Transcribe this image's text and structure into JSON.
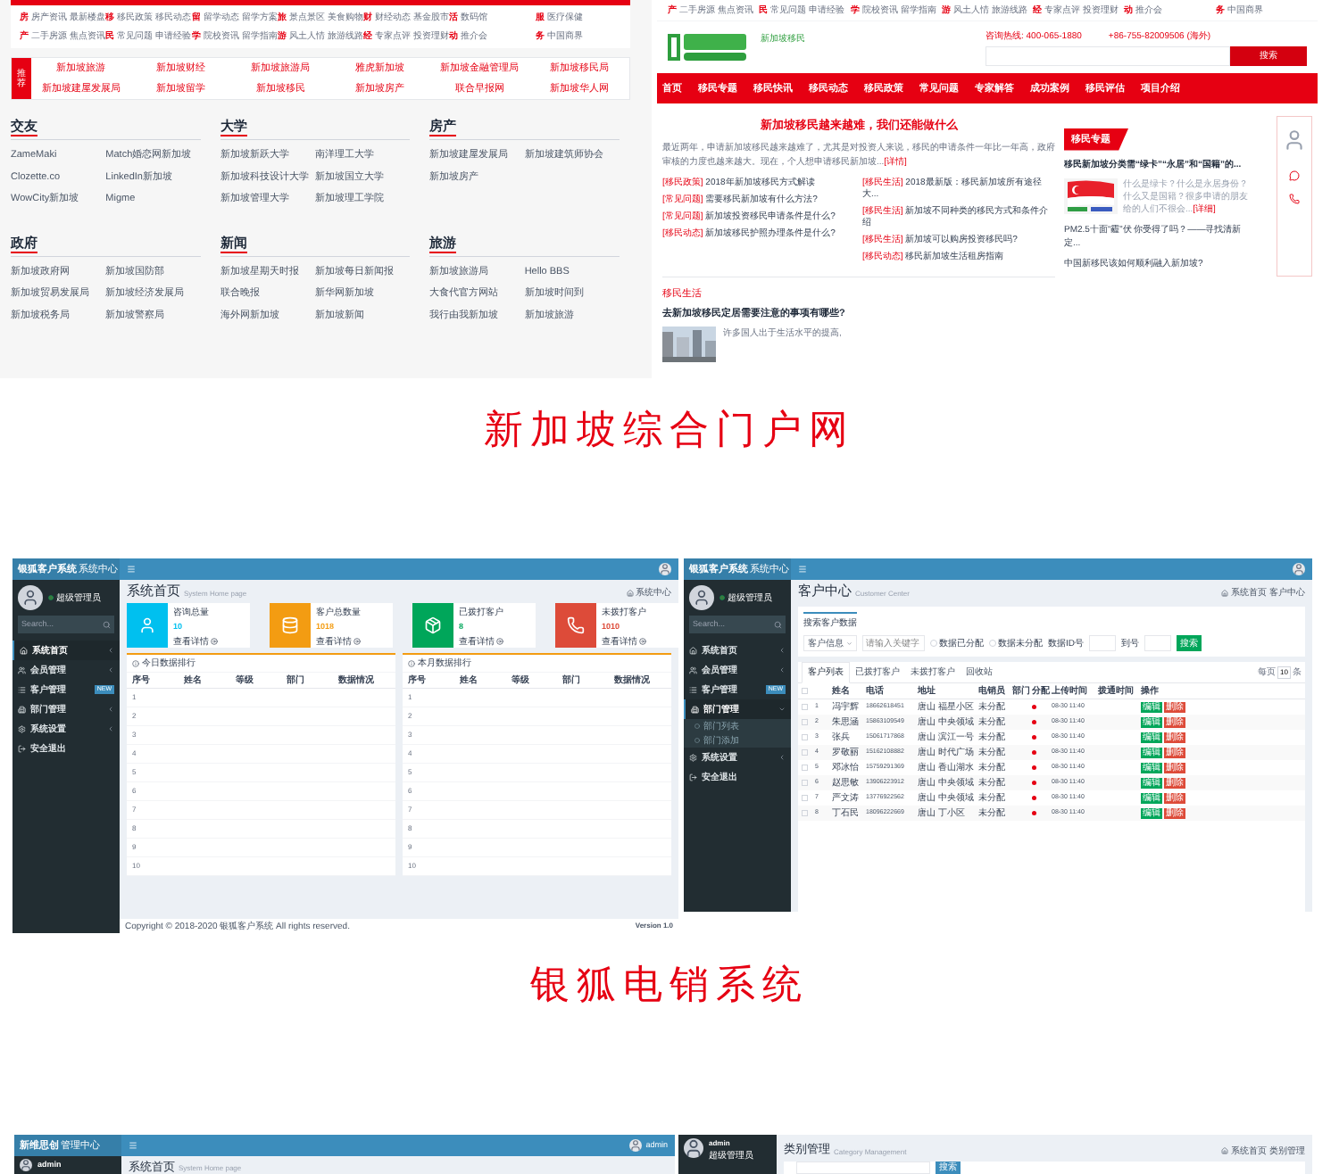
{
  "portal_site": {
    "top_nav": [
      [
        {
          "icon": "房",
          "items": [
            "房产资讯",
            "最新楼盘"
          ]
        },
        {
          "icon": "移",
          "items": [
            "移民政策",
            "移民动态"
          ]
        },
        {
          "icon": "留",
          "items": [
            "留学动态",
            "留学方案"
          ]
        },
        {
          "icon": "旅",
          "items": [
            "景点景区",
            "美食购物"
          ]
        },
        {
          "icon": "财",
          "items": [
            "财经动态",
            "基金股市"
          ]
        },
        {
          "icon": "活",
          "items": [
            "数码馆"
          ]
        },
        {
          "icon": "服",
          "items": [
            "医疗保健"
          ]
        }
      ],
      [
        {
          "icon": "产",
          "items": [
            "二手房源",
            "焦点资讯"
          ]
        },
        {
          "icon": "民",
          "items": [
            "常见问题",
            "申请经验"
          ]
        },
        {
          "icon": "学",
          "items": [
            "院校资讯",
            "留学指南"
          ]
        },
        {
          "icon": "游",
          "items": [
            "风土人情",
            "旅游线路"
          ]
        },
        {
          "icon": "经",
          "items": [
            "专家点评",
            "投资理财"
          ]
        },
        {
          "icon": "动",
          "items": [
            "推介会"
          ]
        },
        {
          "icon": "务",
          "items": [
            "中国商界"
          ]
        }
      ]
    ],
    "recommend": {
      "label": "推荐",
      "links": [
        "新加坡旅游",
        "新加坡财经",
        "新加坡旅游局",
        "雅虎新加坡",
        "新加坡金融管理局",
        "新加坡移民局",
        "新加坡建屋发展局",
        "新加坡留学",
        "新加坡移民",
        "新加坡房产",
        "联合早报网",
        "新加坡华人网"
      ]
    },
    "sections": [
      {
        "title": "交友",
        "links": [
          "ZameMaki",
          "Match婚恋网新加坡",
          "Clozette.co",
          "LinkedIn新加坡",
          "WowCity新加坡",
          "Migme"
        ]
      },
      {
        "title": "大学",
        "links": [
          "新加坡新跃大学",
          "南洋理工大学",
          "新加坡科技设计大学",
          "新加坡国立大学",
          "新加坡管理大学",
          "新加坡理工学院"
        ]
      },
      {
        "title": "房产",
        "links": [
          "新加坡建屋发展局",
          "新加坡建筑师协会",
          "新加坡房产"
        ]
      },
      {
        "title": "政府",
        "links": [
          "新加坡政府网",
          "新加坡国防部",
          "新加坡贸易发展局",
          "新加坡经济发展局",
          "新加坡税务局",
          "新加坡警察局"
        ]
      },
      {
        "title": "新闻",
        "links": [
          "新加坡星期天时报",
          "新加坡每日新闻报",
          "联合晚报",
          "新华网新加坡",
          "海外网新加坡",
          "新加坡新闻"
        ]
      },
      {
        "title": "旅游",
        "links": [
          "新加坡旅游局",
          "Hello BBS",
          "大食代官方网站",
          "新加坡时间到",
          "我行由我新加坡",
          "新加坡旅游"
        ]
      }
    ]
  },
  "immigration_site": {
    "top_nav": [
      {
        "icon": "产",
        "items": [
          "二手房源",
          "焦点资讯"
        ]
      },
      {
        "icon": "民",
        "items": [
          "常见问题",
          "申请经验"
        ]
      },
      {
        "icon": "学",
        "items": [
          "院校资讯",
          "留学指南"
        ]
      },
      {
        "icon": "游",
        "items": [
          "风土人情",
          "旅游线路"
        ]
      },
      {
        "icon": "经",
        "items": [
          "专家点评",
          "投资理财"
        ]
      },
      {
        "icon": "动",
        "items": [
          "推介会"
        ]
      },
      {
        "icon": "务",
        "items": [
          "中国商界"
        ]
      }
    ],
    "logo_tagline": "新加坡移民",
    "hotline": "咨询热线: 400-065-1880",
    "overseas_line": "+86-755-82009506 (海外)",
    "search_button": "搜索",
    "nav": [
      "首页",
      "移民专题",
      "移民快讯",
      "移民动态",
      "移民政策",
      "常见问题",
      "专家解答",
      "成功案例",
      "移民评估",
      "项目介绍"
    ],
    "headline": "新加坡移民越来越难，我们还能做什么",
    "intro": "最近两年，申请新加坡移民越来越难了，尤其是对投资人来说，移民的申请条件一年比一年高，政府审核的力度也越来越大。现在，个人想申请移民新加坡...",
    "intro_more": "[详情]",
    "news": [
      [
        {
          "tag": "[移民政策]",
          "title": "2018年新加坡移民方式解读"
        },
        {
          "tag": "[常见问题]",
          "title": "需要移民新加坡有什么方法?"
        },
        {
          "tag": "[常见问题]",
          "title": "新加坡投资移民申请条件是什么?"
        },
        {
          "tag": "[移民动态]",
          "title": "新加坡移民护照办理条件是什么?"
        }
      ],
      [
        {
          "tag": "[移民生活]",
          "title": "2018最新版：移民新加坡所有途径大..."
        },
        {
          "tag": "[移民生活]",
          "title": "新加坡不同种类的移民方式和条件介绍"
        },
        {
          "tag": "[移民生活]",
          "title": "新加坡可以购房投资移民吗?"
        },
        {
          "tag": "[移民动态]",
          "title": "移民新加坡生活租房指南"
        }
      ]
    ],
    "topic": {
      "tag": "移民专题",
      "title": "移民新加坡分类需“绿卡”“永居”和“国籍”的...",
      "summary": "什么是绿卡？什么是永居身份？什么又是国籍？很多申请的朋友给的人们不很会...",
      "more": "[详细]",
      "links": [
        "PM2.5十面“霾”伏 你受得了吗？——寻找清新定...",
        "中国新移民该如何顺利融入新加坡?"
      ]
    },
    "life": {
      "heading": "移民生活",
      "title": "去新加坡移民定居需要注意的事项有哪些?",
      "summary": "许多国人出于生活水平的提高,"
    }
  },
  "caption_1": "新加坡综合门户网",
  "crm_dashboard": {
    "brand": "银狐客户系统",
    "brand_sub": "系统中心",
    "role": "超级管理员",
    "search_placeholder": "Search...",
    "menu": [
      {
        "label": "系统首页",
        "selected": true,
        "expanded": false
      },
      {
        "label": "会员管理",
        "selected": false,
        "expanded": false
      },
      {
        "label": "客户管理",
        "selected": false,
        "badge": "NEW"
      },
      {
        "label": "部门管理",
        "selected": false,
        "expanded": false
      },
      {
        "label": "系统设置",
        "selected": false,
        "expanded": false
      },
      {
        "label": "安全退出",
        "selected": false
      }
    ],
    "title": "系统首页",
    "subtitle": "System Home page",
    "breadcrumb": "系统中心",
    "stats": [
      {
        "label": "咨询总量",
        "value": "10",
        "color": "#00c0ef",
        "link": "查看详情"
      },
      {
        "label": "客户总数量",
        "value": "1018",
        "color": "#f39c12",
        "link": "查看详情"
      },
      {
        "label": "已拨打客户",
        "value": "8",
        "color": "#00a65a",
        "link": "查看详情"
      },
      {
        "label": "未拨打客户",
        "value": "1010",
        "color": "#dd4b39",
        "link": "查看详情"
      }
    ],
    "tables": [
      {
        "title": "今日数据排行",
        "columns": [
          "序号",
          "姓名",
          "等级",
          "部门",
          "数据情况"
        ],
        "rows": [
          "1",
          "2",
          "3",
          "4",
          "5",
          "6",
          "7",
          "8",
          "9",
          "10"
        ]
      },
      {
        "title": "本月数据排行",
        "columns": [
          "序号",
          "姓名",
          "等级",
          "部门",
          "数据情况"
        ],
        "rows": [
          "1",
          "2",
          "3",
          "4",
          "5",
          "6",
          "7",
          "8",
          "9",
          "10"
        ]
      }
    ],
    "footer": "Copyright © 2018-2020 银狐客户系统 All rights reserved.",
    "version": "Version 1.0"
  },
  "crm_customers": {
    "brand": "银狐客户系统",
    "brand_sub": "系统中心",
    "role": "超级管理员",
    "search_placeholder": "Search...",
    "menu": [
      {
        "label": "系统首页",
        "selected": false,
        "expanded": false
      },
      {
        "label": "会员管理",
        "selected": false,
        "expanded": false
      },
      {
        "label": "客户管理",
        "selected": false,
        "badge": "NEW"
      },
      {
        "label": "部门管理",
        "selected": true,
        "expanded": true,
        "children": [
          "部门列表",
          "部门添加"
        ]
      },
      {
        "label": "系统设置",
        "selected": false,
        "expanded": false
      },
      {
        "label": "安全退出",
        "selected": false
      }
    ],
    "title": "客户中心",
    "subtitle": "Customer Center",
    "breadcrumb": [
      "系统首页",
      "客户中心"
    ],
    "search_title": "搜索客户数据",
    "field_select": "客户信息",
    "keyword_placeholder": "请输入关键字",
    "radios": [
      {
        "label": "数据已分配",
        "selected": false
      },
      {
        "label": "数据未分配",
        "selected": false
      }
    ],
    "id_from": "数据ID号",
    "id_to": "到号",
    "search_button": "搜索",
    "tabs": [
      {
        "label": "客户列表",
        "selected": true
      },
      {
        "label": "已拨打客户",
        "selected": false
      },
      {
        "label": "未拨打客户",
        "selected": false
      },
      {
        "label": "回收站",
        "selected": false
      }
    ],
    "page_size_label": "每页",
    "page_size": "10",
    "page_size_unit": "条",
    "select_all_checked": false,
    "columns": [
      "姓名",
      "电话",
      "地址",
      "电销员",
      "部门",
      "分配",
      "上传时间",
      "拨通时间",
      "操作"
    ],
    "rows": [
      {
        "checked": false,
        "no": "1",
        "name": "冯宇辉",
        "phone": "18662618451",
        "address": "唐山 福星小区",
        "agent": "未分配",
        "time": "08-30 11:40",
        "edit": "编辑",
        "delete": "删除"
      },
      {
        "checked": false,
        "no": "2",
        "name": "朱思涵",
        "phone": "15863109549",
        "address": "唐山 中央领域",
        "agent": "未分配",
        "time": "08-30 11:40",
        "edit": "编辑",
        "delete": "删除"
      },
      {
        "checked": false,
        "no": "3",
        "name": "张兵",
        "phone": "15061717868",
        "address": "唐山 滨江一号",
        "agent": "未分配",
        "time": "08-30 11:40",
        "edit": "编辑",
        "delete": "删除"
      },
      {
        "checked": false,
        "no": "4",
        "name": "罗敬丽",
        "phone": "15162108882",
        "address": "唐山 时代广场",
        "agent": "未分配",
        "time": "08-30 11:40",
        "edit": "编辑",
        "delete": "删除"
      },
      {
        "checked": false,
        "no": "5",
        "name": "邓冰怡",
        "phone": "15759291369",
        "address": "唐山 香山湖水",
        "agent": "未分配",
        "time": "08-30 11:40",
        "edit": "编辑",
        "delete": "删除"
      },
      {
        "checked": false,
        "no": "6",
        "name": "赵思敏",
        "phone": "13906223912",
        "address": "唐山 中央领域",
        "agent": "未分配",
        "time": "08-30 11:40",
        "edit": "编辑",
        "delete": "删除"
      },
      {
        "checked": false,
        "no": "7",
        "name": "严文涛",
        "phone": "13776922562",
        "address": "唐山 中央领域",
        "agent": "未分配",
        "time": "08-30 11:40",
        "edit": "编辑",
        "delete": "删除"
      },
      {
        "checked": false,
        "no": "8",
        "name": "丁石民",
        "phone": "18096222669",
        "address": "唐山 丁小区",
        "agent": "未分配",
        "time": "08-30 11:40",
        "edit": "编辑",
        "delete": "删除"
      }
    ]
  },
  "caption_2": "银狐电销系统",
  "admin_home": {
    "brand": "新维思创",
    "brand_sub": "管理中心",
    "user": "admin",
    "sidebar_user": "admin",
    "title": "系统首页",
    "subtitle": "System Home page"
  },
  "admin_categories": {
    "user": "admin",
    "role": "超级管理员",
    "title": "类别管理",
    "subtitle": "Category Management",
    "breadcrumb": [
      "系统首页",
      "类别管理"
    ],
    "search_button": "搜索"
  }
}
